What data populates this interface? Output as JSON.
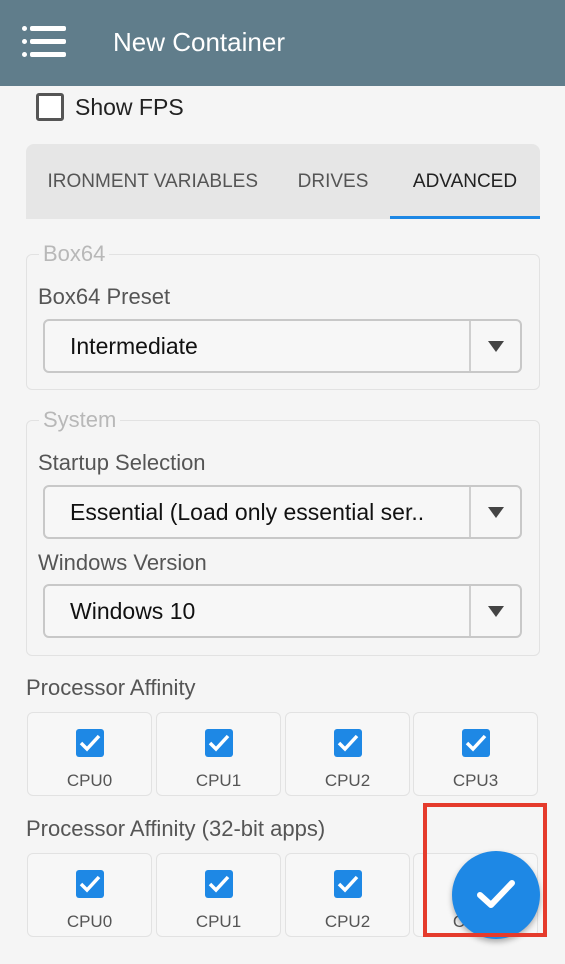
{
  "header": {
    "title": "New Container"
  },
  "show_fps": {
    "label": "Show FPS",
    "checked": false
  },
  "tabs": [
    {
      "label": "ENVIRONMENT VARIABLES",
      "visible_text": "IRONMENT VARIABLES"
    },
    {
      "label": "DRIVES"
    },
    {
      "label": "ADVANCED",
      "active": true
    }
  ],
  "box64": {
    "legend": "Box64",
    "preset_label": "Box64 Preset",
    "preset_value": "Intermediate"
  },
  "system": {
    "legend": "System",
    "startup_label": "Startup Selection",
    "startup_value": "Essential (Load only essential ser..",
    "windows_label": "Windows Version",
    "windows_value": "Windows 10"
  },
  "affinity": {
    "label": "Processor Affinity",
    "cpus": [
      {
        "label": "CPU0",
        "checked": true
      },
      {
        "label": "CPU1",
        "checked": true
      },
      {
        "label": "CPU2",
        "checked": true
      },
      {
        "label": "CPU3",
        "checked": true
      }
    ]
  },
  "affinity32": {
    "label": "Processor Affinity (32-bit apps)",
    "cpus": [
      {
        "label": "CPU0",
        "checked": true
      },
      {
        "label": "CPU1",
        "checked": true
      },
      {
        "label": "CPU2",
        "checked": true
      },
      {
        "label": "CPU3",
        "checked": true
      }
    ]
  },
  "fab": {
    "icon": "check-icon"
  },
  "colors": {
    "appbar": "#607d8b",
    "accent": "#1e88e5",
    "highlight": "#e53b2c"
  }
}
